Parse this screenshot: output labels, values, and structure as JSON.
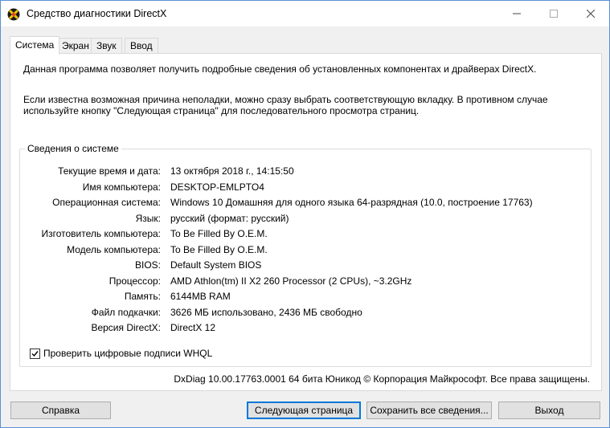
{
  "window": {
    "title": "Средство диагностики DirectX",
    "controls": {
      "minimize": "—",
      "maximize": "☐",
      "close": "✕"
    }
  },
  "tabs": [
    {
      "label": "Система",
      "active": true
    },
    {
      "label": "Экран",
      "active": false
    },
    {
      "label": "Звук",
      "active": false
    },
    {
      "label": "Ввод",
      "active": false
    }
  ],
  "intro": {
    "line1": "Данная программа позволяет получить подробные сведения об установленных компонентах и драйверах DirectX.",
    "line2": "Если известна возможная причина неполадки, можно сразу выбрать соответствующую вкладку. В противном случае используйте кнопку \"Следующая страница\" для последовательного просмотра страниц."
  },
  "system_info": {
    "group_title": "Сведения о системе",
    "rows": [
      {
        "label": "Текущие время и дата:",
        "value": "13 октября 2018 г., 14:15:50"
      },
      {
        "label": "Имя компьютера:",
        "value": "DESKTOP-EMLPTO4"
      },
      {
        "label": "Операционная система:",
        "value": "Windows 10 Домашняя для одного языка 64-разрядная (10.0, построение 17763)"
      },
      {
        "label": "Язык:",
        "value": "русский (формат: русский)"
      },
      {
        "label": "Изготовитель компьютера:",
        "value": "To Be Filled By O.E.M."
      },
      {
        "label": "Модель компьютера:",
        "value": "To Be Filled By O.E.M."
      },
      {
        "label": "BIOS:",
        "value": "Default System BIOS"
      },
      {
        "label": "Процессор:",
        "value": "AMD Athlon(tm) II X2 260 Processor (2 CPUs), ~3.2GHz"
      },
      {
        "label": "Память:",
        "value": "6144MB RAM"
      },
      {
        "label": "Файл подкачки:",
        "value": "3626 МБ использовано, 2436 МБ свободно"
      },
      {
        "label": "Версия DirectX:",
        "value": "DirectX 12"
      }
    ]
  },
  "whql_checkbox": {
    "label": "Проверить цифровые подписи WHQL",
    "checked": true
  },
  "footer": "DxDiag 10.00.17763.0001 64 бита Юникод © Корпорация Майкрософт. Все права защищены.",
  "buttons": {
    "help": "Справка",
    "next_page": "Следующая страница",
    "save_all": "Сохранить все сведения...",
    "exit": "Выход"
  },
  "icons": {
    "app": "directx-icon",
    "check": "check-icon"
  },
  "colors": {
    "window_border": "#5a8fd6",
    "default_button_border": "#0078d7"
  }
}
